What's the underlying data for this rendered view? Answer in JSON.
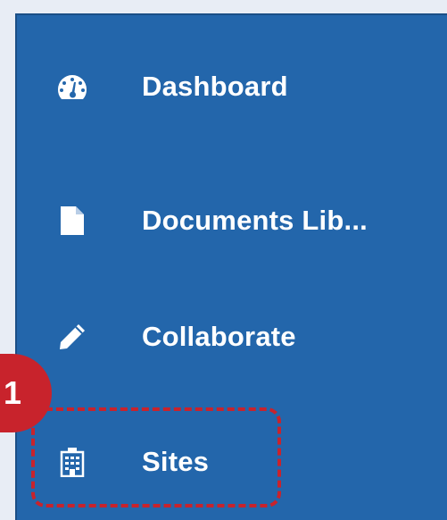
{
  "sidebar": {
    "items": [
      {
        "label": "Dashboard",
        "icon": "dashboard-gauge-icon"
      },
      {
        "label": "Documents Lib...",
        "icon": "document-icon"
      },
      {
        "label": "Collaborate",
        "icon": "pencil-icon"
      },
      {
        "label": "Sites",
        "icon": "building-icon"
      }
    ]
  },
  "annotation": {
    "step_number": "1",
    "highlight_color": "#c8232c"
  },
  "colors": {
    "sidebar_bg": "#2366ab",
    "text": "#ffffff"
  }
}
